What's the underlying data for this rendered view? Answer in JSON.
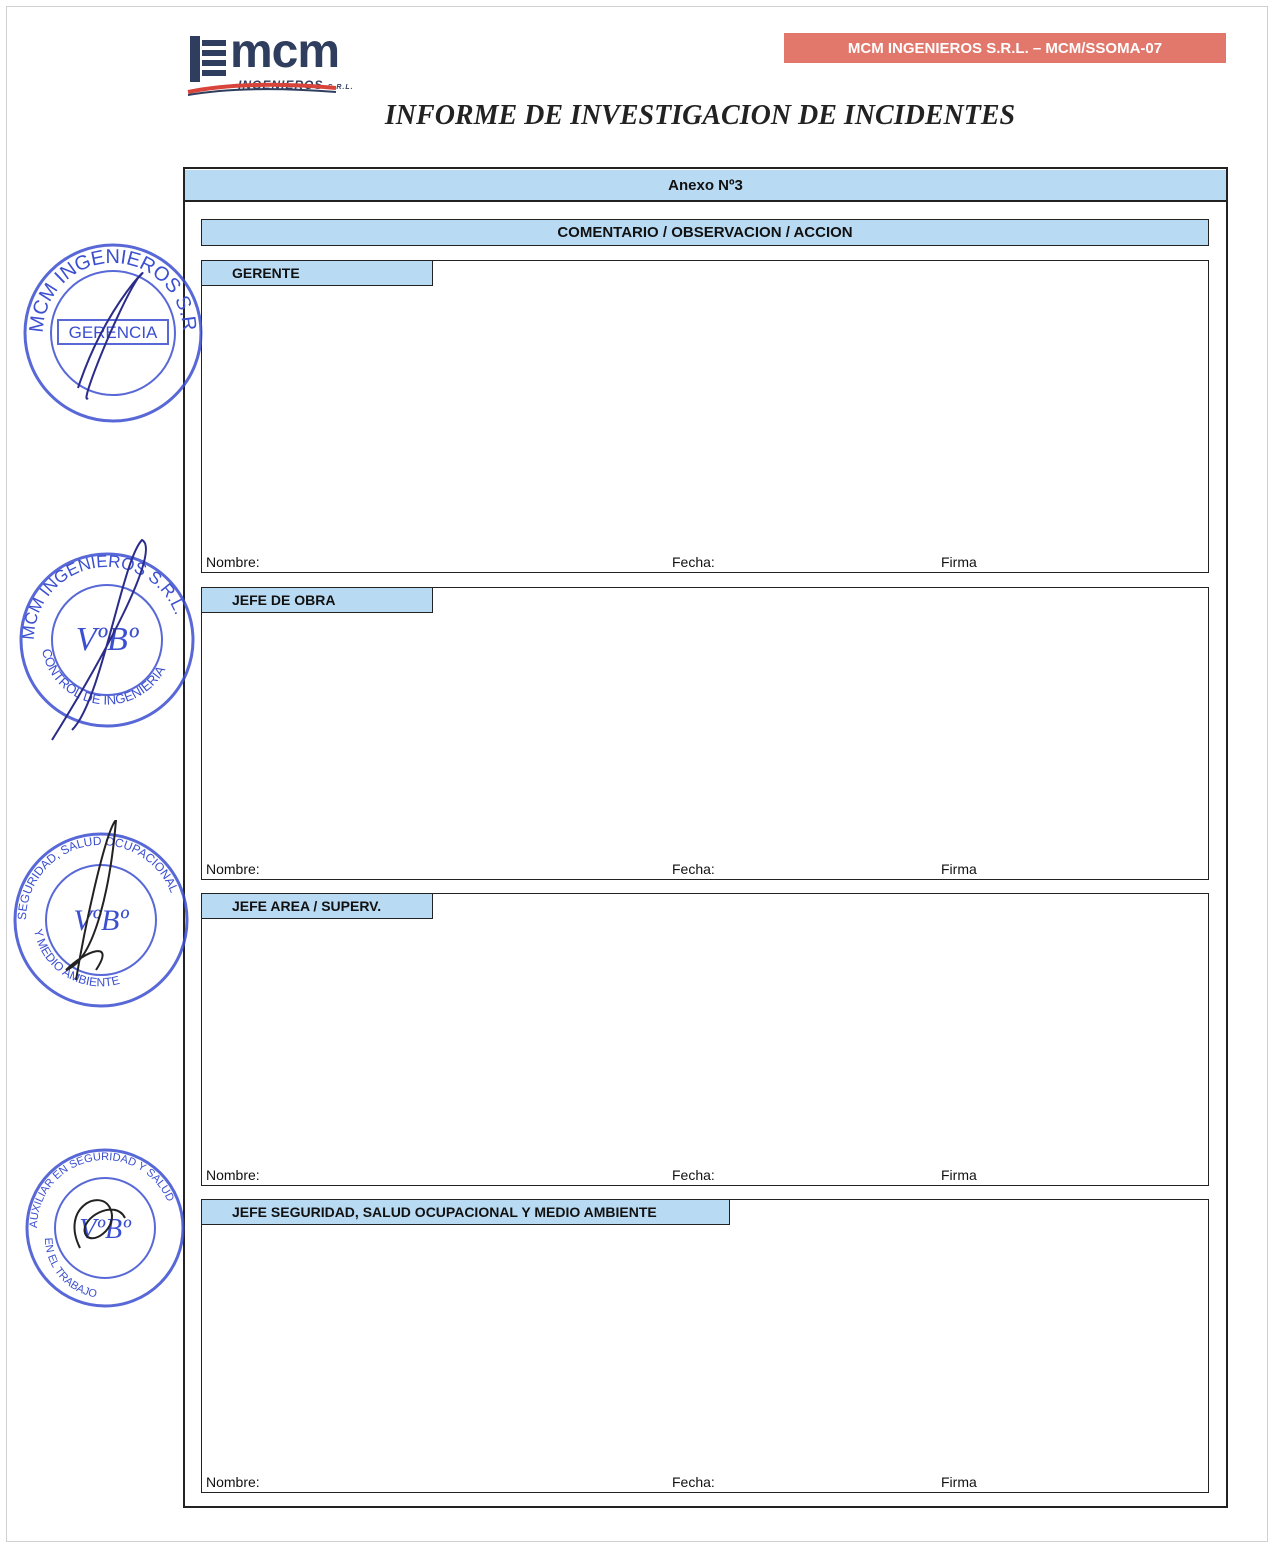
{
  "header": {
    "logo_text": "mcm",
    "logo_sub": "INGENIEROS",
    "logo_suffix": "S.R.L.",
    "code_badge": "MCM INGENIEROS S.R.L. – MCM/SSOMA-07",
    "title": "INFORME DE INVESTIGACION DE INCIDENTES"
  },
  "form": {
    "annex": "Anexo Nº3",
    "comment_heading": "COMENTARIO / OBSERVACION / ACCION",
    "sections": [
      {
        "label": "GERENTE",
        "nombre": "Nombre:",
        "fecha": "Fecha:",
        "firma": "Firma"
      },
      {
        "label": "JEFE DE OBRA",
        "nombre": "Nombre:",
        "fecha": "Fecha:",
        "firma": "Firma"
      },
      {
        "label": "JEFE AREA / SUPERV.",
        "nombre": "Nombre:",
        "fecha": "Fecha:",
        "firma": "Firma"
      },
      {
        "label": "JEFE SEGURIDAD, SALUD OCUPACIONAL Y MEDIO AMBIENTE",
        "nombre": "Nombre:",
        "fecha": "Fecha:",
        "firma": "Firma"
      }
    ]
  },
  "stamps": [
    {
      "outer": "MCM INGENIEROS S.R.L.",
      "center": "GERENCIA"
    },
    {
      "outer": "MCM INGENIEROS S.R.L.",
      "center": "VºBº",
      "bottom": "CONTROL DE INGENIERIA"
    },
    {
      "outer": "SEGURIDAD, SALUD OCUPACIONAL Y MEDIO AMBIENTE",
      "center": "VºBº"
    },
    {
      "outer": "AUXILIAR EN SEGURIDAD Y SALUD EN EL TRABAJO",
      "center": "VºBº"
    }
  ],
  "colors": {
    "header_fill": "#b9daf3",
    "badge": "#e2776c",
    "stamp_ink": "#3b4fd0",
    "brand": "#2f3e5e"
  }
}
